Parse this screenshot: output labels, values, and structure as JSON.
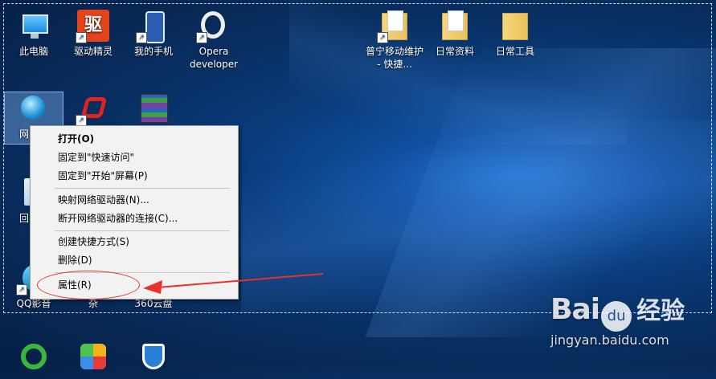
{
  "desktop": {
    "icons_top": [
      {
        "label": "此电脑"
      },
      {
        "label": "驱动精灵"
      },
      {
        "label": "我的手机"
      },
      {
        "label": "Opera developer"
      },
      {
        "label": "普宁移动维护 - 快捷..."
      },
      {
        "label": "日常资料"
      },
      {
        "label": "日常工具"
      }
    ],
    "icons_mid": [
      {
        "label": "网"
      },
      {
        "label": ""
      },
      {
        "label": ""
      }
    ],
    "icons_lower": [
      {
        "label": "回"
      },
      {
        "label": "QQ影音"
      },
      {
        "label": "杂"
      },
      {
        "label": "360云盘"
      }
    ],
    "icons_bottom": [
      {
        "label": ""
      },
      {
        "label": ""
      },
      {
        "label": ""
      }
    ]
  },
  "context_menu": {
    "items": [
      {
        "label": "打开(O)"
      },
      {
        "label": "固定到\"快速访问\""
      },
      {
        "label": "固定到\"开始\"屏幕(P)"
      },
      {
        "label": "映射网络驱动器(N)..."
      },
      {
        "label": "断开网络驱动器的连接(C)..."
      },
      {
        "label": "创建快捷方式(S)"
      },
      {
        "label": "删除(D)"
      },
      {
        "label": "属性(R)"
      }
    ]
  },
  "annotation": {
    "arrow_color": "#e8302d",
    "highlight_target": "属性(R)"
  },
  "watermark": {
    "logo_text_a": "Bai",
    "logo_paw": "du",
    "logo_cn": "经验",
    "url": "jingyan.baidu.com"
  },
  "colors": {
    "desktop_bg": "#0a3d7e",
    "menu_bg": "#f2f2f2",
    "annotation_red": "#e8302d"
  }
}
